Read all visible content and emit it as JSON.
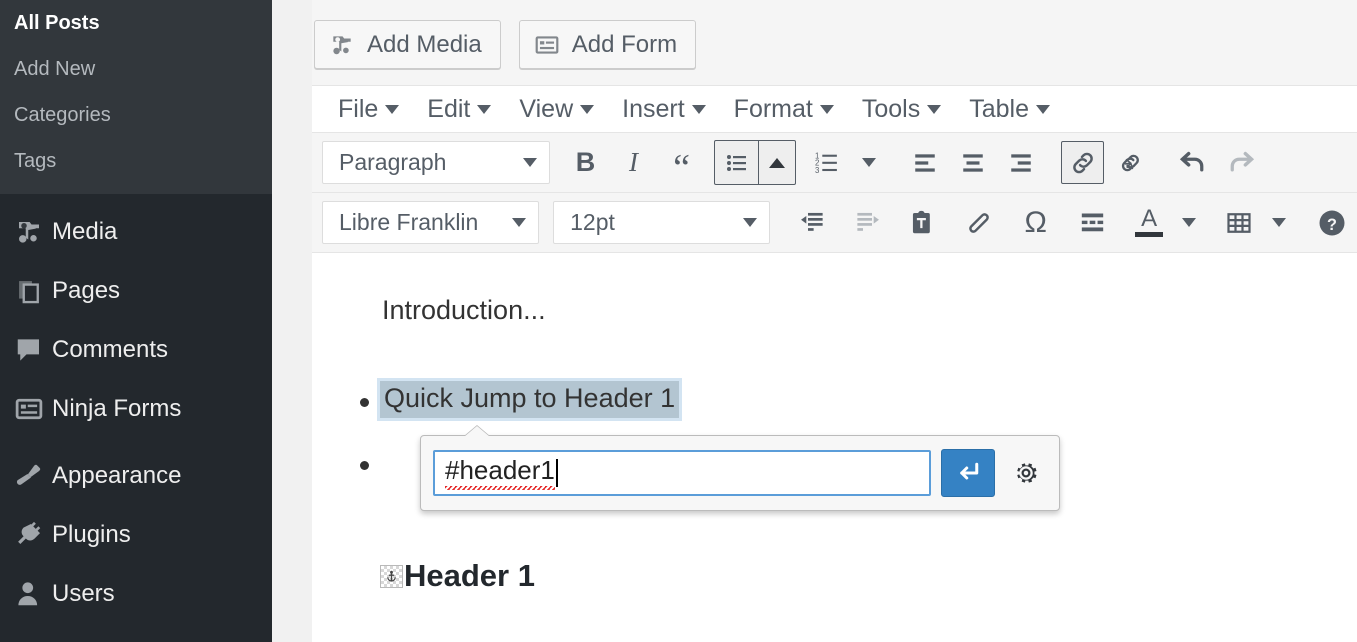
{
  "sidebar": {
    "submenu": [
      {
        "label": "All Posts",
        "current": true
      },
      {
        "label": "Add New",
        "current": false
      },
      {
        "label": "Categories",
        "current": false
      },
      {
        "label": "Tags",
        "current": false
      }
    ],
    "items": [
      {
        "label": "Media",
        "icon": "media-icon"
      },
      {
        "label": "Pages",
        "icon": "pages-icon"
      },
      {
        "label": "Comments",
        "icon": "comments-icon"
      },
      {
        "label": "Ninja Forms",
        "icon": "forms-icon"
      },
      {
        "label": "Appearance",
        "icon": "paintbrush-icon"
      },
      {
        "label": "Plugins",
        "icon": "plug-icon"
      },
      {
        "label": "Users",
        "icon": "user-icon"
      }
    ],
    "background": "#23282d",
    "submenu_background": "#32373c"
  },
  "media_bar": {
    "add_media_label": "Add Media",
    "add_form_label": "Add Form"
  },
  "menubar": {
    "items": [
      "File",
      "Edit",
      "View",
      "Insert",
      "Format",
      "Tools",
      "Table"
    ]
  },
  "toolbar_row1": {
    "paragraph_style": "Paragraph",
    "bold_label": "B",
    "italic_label": "I",
    "blockquote_label": "“",
    "buttons": [
      "bold-button",
      "italic-button",
      "blockquote-button",
      "bulleted-list-button",
      "bulleted-list-caret",
      "numbered-list-button",
      "numbered-list-caret",
      "align-left-button",
      "align-center-button",
      "align-right-button",
      "insert-link-button",
      "remove-link-button",
      "undo-button",
      "redo-button"
    ],
    "active_buttons": [
      "bulleted-list-button",
      "insert-link-button"
    ],
    "disabled_buttons": [
      "redo-button"
    ]
  },
  "toolbar_row2": {
    "font_family": "Libre Franklin",
    "font_size": "12pt",
    "special_char_label": "Ω",
    "text_color_label": "A",
    "help_label": "?",
    "buttons": [
      "decrease-indent-button",
      "increase-indent-button",
      "paste-as-text-button",
      "clear-formatting-button",
      "special-character-button",
      "read-more-button",
      "text-color-button",
      "text-color-caret",
      "table-button",
      "table-caret",
      "help-button"
    ],
    "disabled_buttons": [
      "increase-indent-button"
    ]
  },
  "content": {
    "paragraph": "Introduction...",
    "list_item_selected": "Quick Jump to Header 1",
    "heading": "Header 1"
  },
  "link_popup": {
    "url_value": "#header1",
    "apply_title": "Apply",
    "options_title": "Link options",
    "accent_color": "#3582c4",
    "focus_border": "#5b9dd9"
  }
}
